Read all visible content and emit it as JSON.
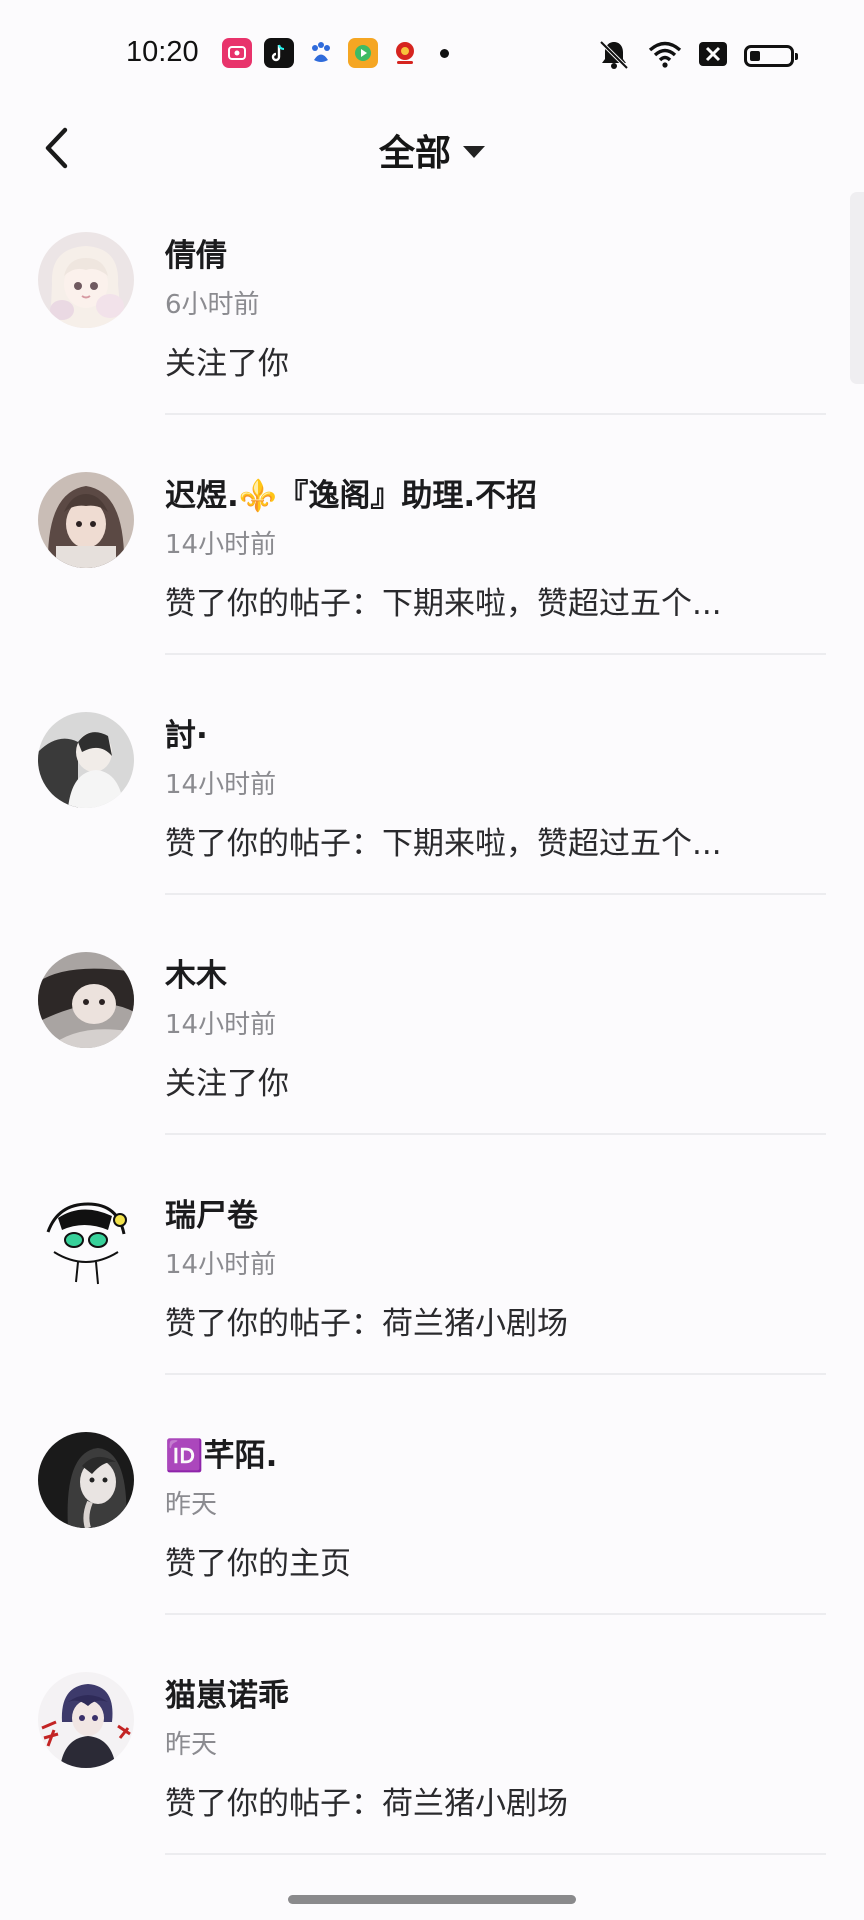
{
  "status_bar": {
    "time": "10:20"
  },
  "header": {
    "title": "全部"
  },
  "notifications": [
    {
      "name": "倩倩",
      "time": "6小时前",
      "message": "关注了你"
    },
    {
      "name": "迟煜.⚜️『逸阁』助理.不招",
      "time": "14小时前",
      "message": "赞了你的帖子：下期来啦，赞超过五个..."
    },
    {
      "name": "討·",
      "time": "14小时前",
      "message": "赞了你的帖子：下期来啦，赞超过五个..."
    },
    {
      "name": "木木",
      "time": "14小时前",
      "message": "关注了你"
    },
    {
      "name": "瑞尸卷",
      "time": "14小时前",
      "message": "赞了你的帖子：荷兰猪小剧场"
    },
    {
      "name": "🆔芊陌.",
      "time": "昨天",
      "message": "赞了你的主页"
    },
    {
      "name": "猫崽诺乖",
      "time": "昨天",
      "message": "赞了你的帖子：荷兰猪小剧场"
    }
  ]
}
